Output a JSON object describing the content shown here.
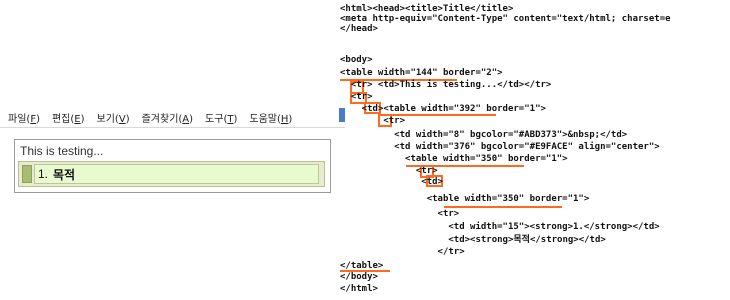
{
  "menu": [
    {
      "label": "파일(",
      "key": "F",
      "tail": ")"
    },
    {
      "label": "편집(",
      "key": "E",
      "tail": ")"
    },
    {
      "label": "보기(",
      "key": "V",
      "tail": ")"
    },
    {
      "label": "즐겨찾기(",
      "key": "A",
      "tail": ")"
    },
    {
      "label": "도구(",
      "key": "T",
      "tail": ")"
    },
    {
      "label": "도움말(",
      "key": "H",
      "tail": ")"
    }
  ],
  "preview": {
    "text": "This is testing...",
    "item_number": "1.",
    "item_title": "목적"
  },
  "colors": {
    "strip": "#A8BD73",
    "cell": "#E9FACE",
    "highlight": "#FF6A1F"
  },
  "code": [
    "<html><head><title>Title</title>",
    "<meta http-equiv=\"Content-Type\" content=\"text/html; charset=e",
    "</head>",
    "",
    "<body>",
    "<table width=\"144\" border=\"2\">",
    "  <tr> <td>This is testing...</td></tr>",
    "  <tr>",
    "    <td><table width=\"392\" border=\"1\">",
    "        <tr>",
    "          <td width=\"8\" bgcolor=\"#ABD373\">&nbsp;</td>",
    "          <td width=\"376\" bgcolor=\"#E9FACE\" align=\"center\">",
    "            <table width=\"350\" border=\"1\">",
    "              <tr>",
    "               <td>",
    "                <table width=\"350\" border=\"1\">",
    "                  <tr>",
    "                    <td width=\"15\"><strong>1.</strong></td>",
    "                    <td><strong>목적</strong></td>",
    "                  </tr>",
    "",
    "</table>",
    "</body>",
    "</html>"
  ]
}
